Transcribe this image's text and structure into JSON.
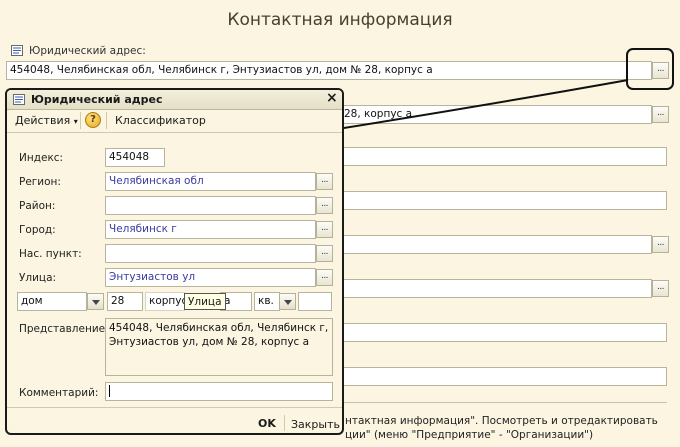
{
  "page": {
    "title": "Контактная информация",
    "legal_address_label": "Юридический адрес:",
    "legal_address_value": "454048, Челябинская обл, Челябинск г, Энтузиастов ул, дом № 28, корпус а",
    "second_address_partial": "28, корпус а",
    "dots_label": "...",
    "bottom_line1": "нтактная информация\". Посмотреть и отредактировать",
    "bottom_line2": "ции\" (меню \"Предприятие\" - \"Организации\")"
  },
  "dialog": {
    "title": "Юридический адрес",
    "close_label": "×",
    "toolbar": {
      "actions_label": "Действия",
      "help_label": "?",
      "classifier_label": "Классификатор"
    },
    "fields": {
      "index_label": "Индекс:",
      "index_value": "454048",
      "region_label": "Регион:",
      "region_value": "Челябинская обл",
      "district_label": "Район:",
      "district_value": "",
      "city_label": "Город:",
      "city_value": "Челябинск г",
      "locality_label": "Нас. пункт:",
      "locality_value": "",
      "street_label": "Улица:",
      "street_value": "Энтузиастов ул",
      "house_type": "дом",
      "house_value": "28",
      "building_type": "корпус",
      "building_value": "а",
      "apartment_type": "кв.",
      "apartment_value": "",
      "tooltip": "Улица",
      "representation_label": "Представление:",
      "representation_value": "454048, Челябинская обл, Челябинск г, Энтузиастов ул, дом № 28, корпус а",
      "comment_label": "Комментарий:",
      "comment_value": ""
    },
    "footer": {
      "ok_label": "OK",
      "close_label": "Закрыть"
    }
  }
}
